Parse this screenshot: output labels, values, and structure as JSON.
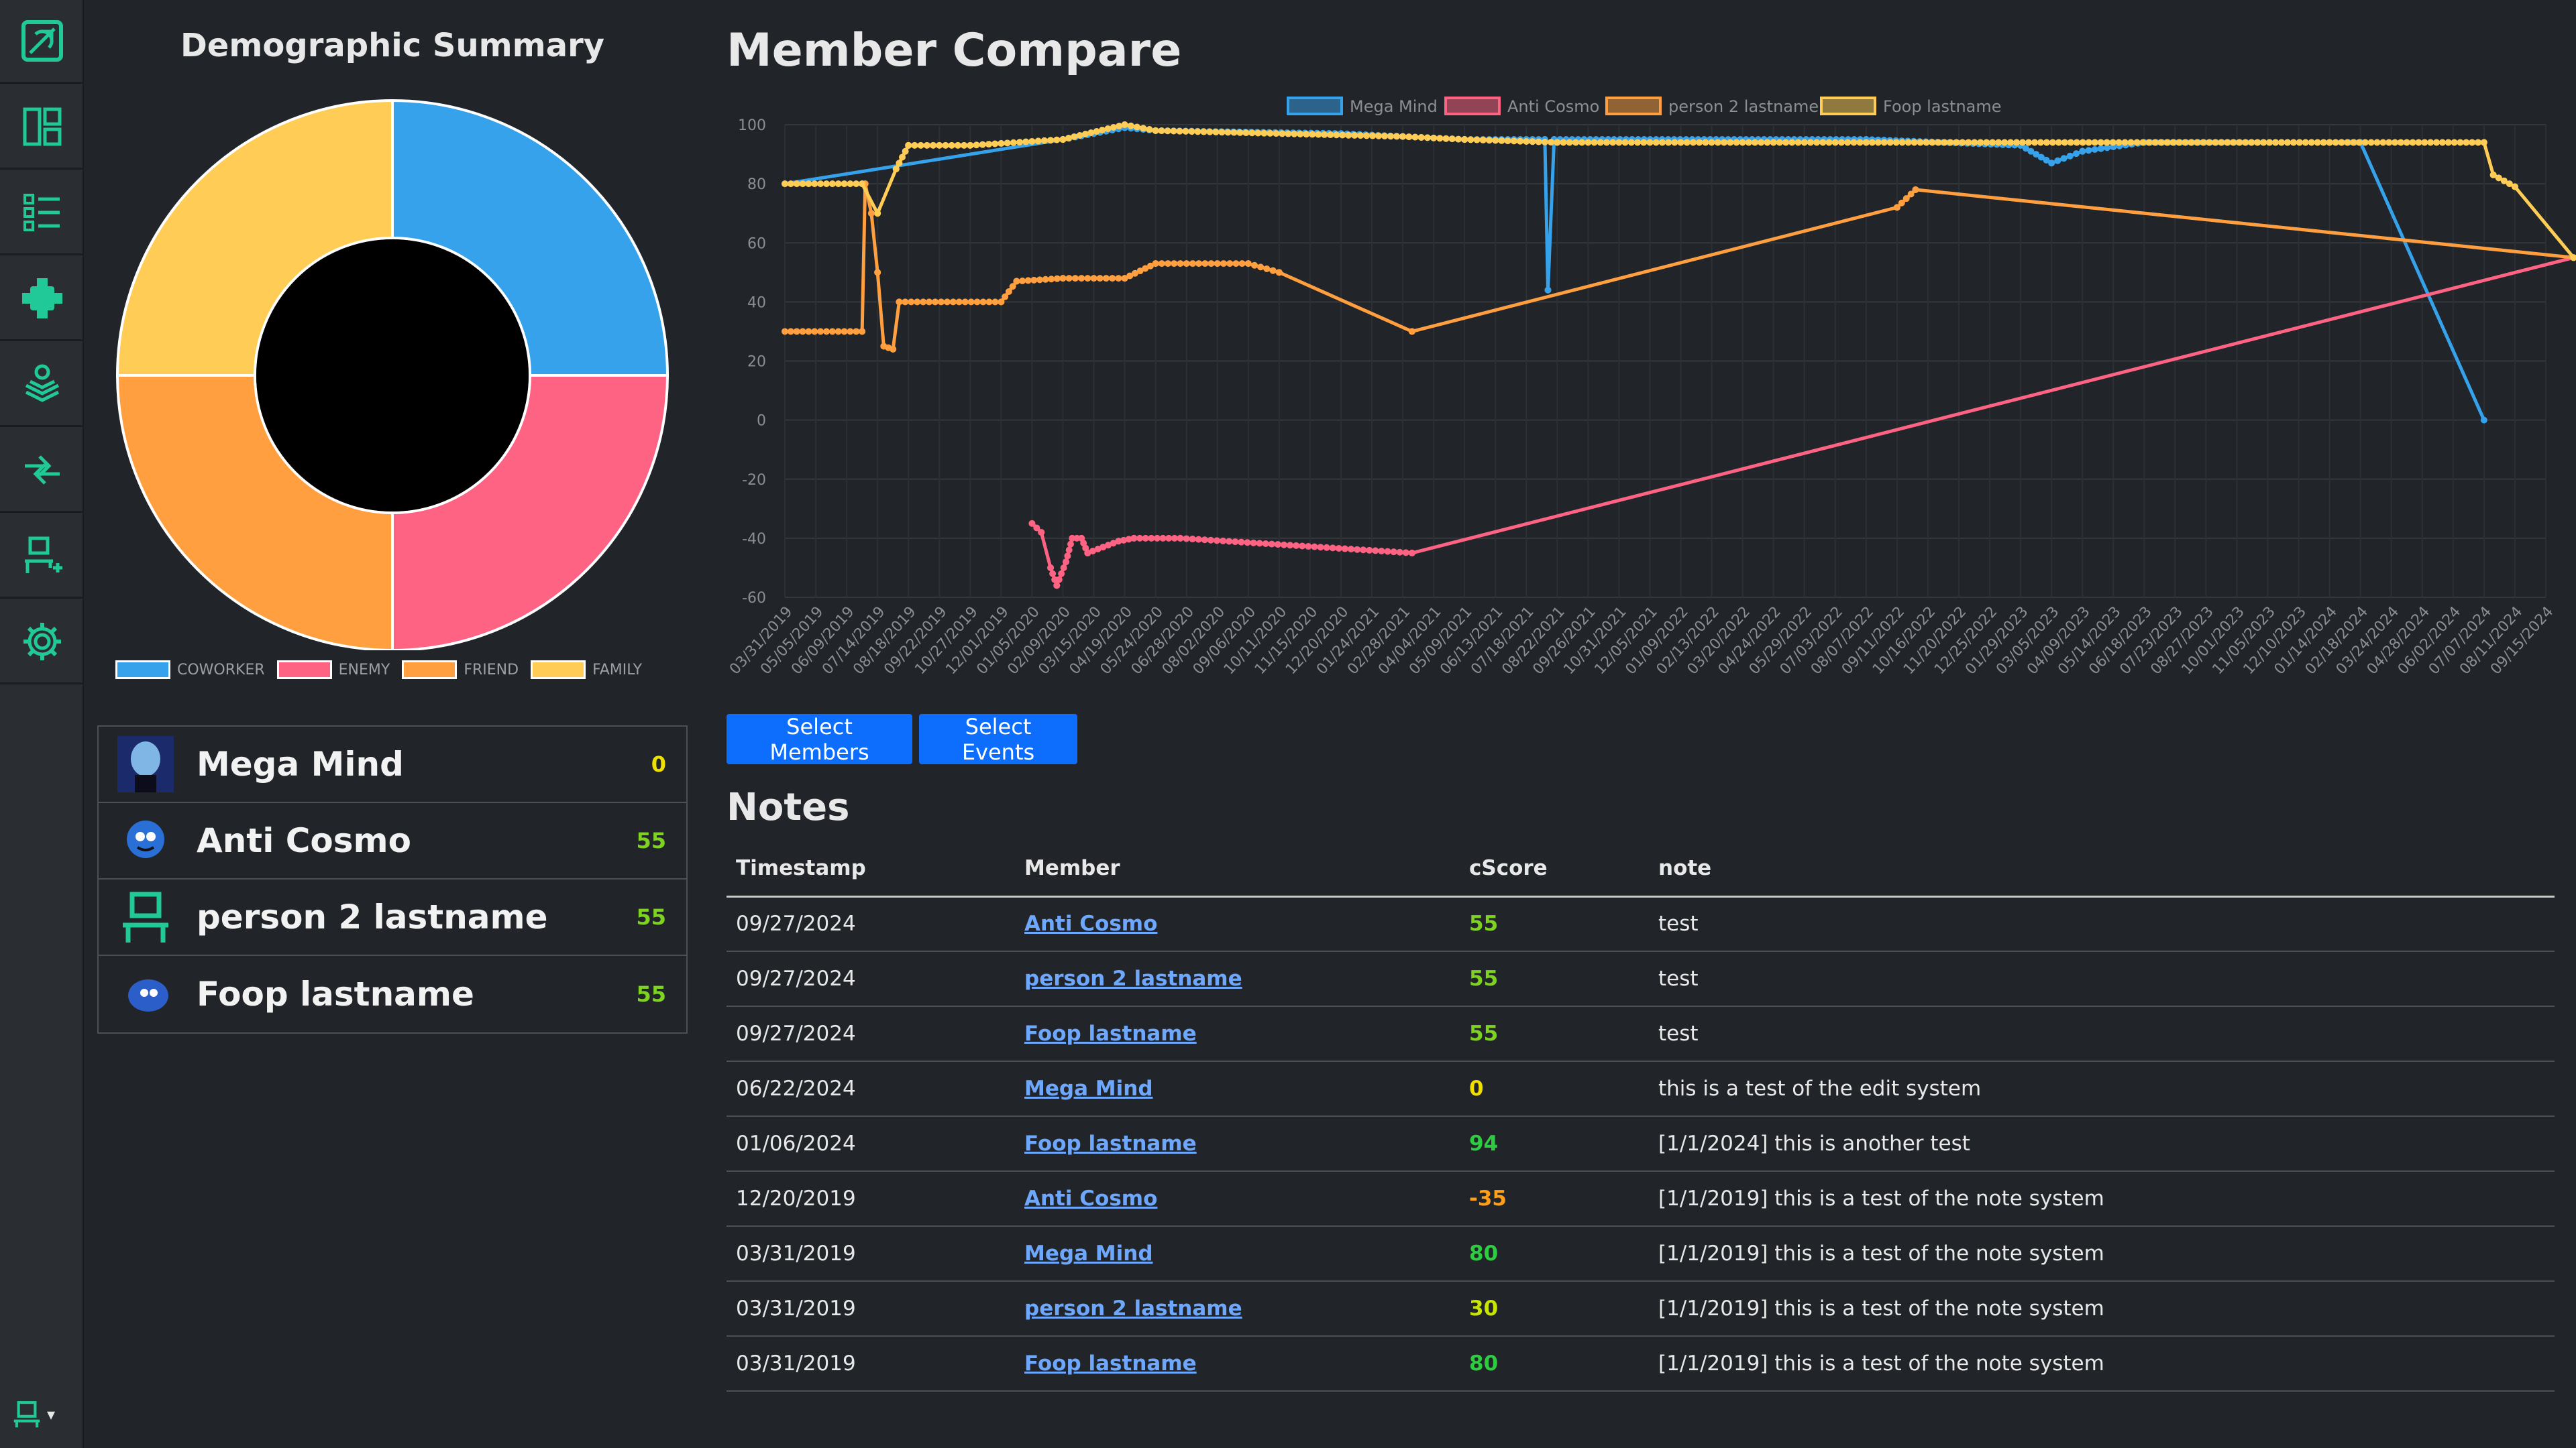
{
  "sidebar": {
    "items": [
      {
        "icon": "logo-icon"
      },
      {
        "icon": "dashboard-icon"
      },
      {
        "icon": "list-icon"
      },
      {
        "icon": "relationship-icon"
      },
      {
        "icon": "stack-icon"
      },
      {
        "icon": "compare-arrows-icon"
      },
      {
        "icon": "add-member-icon"
      },
      {
        "icon": "gear-icon"
      }
    ],
    "accent": "#20c997",
    "user_menu": {
      "icon": "user-icon",
      "caret": "▾"
    }
  },
  "demographic": {
    "title": "Demographic Summary",
    "segments": [
      {
        "label": "COWORKER",
        "value": 1,
        "color": "#36a2eb"
      },
      {
        "label": "ENEMY",
        "value": 1,
        "color": "#ff6384"
      },
      {
        "label": "FRIEND",
        "value": 1,
        "color": "#ff9f40"
      },
      {
        "label": "FAMILY",
        "value": 1,
        "color": "#ffcd56"
      }
    ]
  },
  "members": [
    {
      "name": "Mega Mind",
      "score": "0",
      "score_color": "#f0e000",
      "avatar": "megamind-avatar"
    },
    {
      "name": "Anti Cosmo",
      "score": "55",
      "score_color": "#7ed321",
      "avatar": "anticosmo-avatar"
    },
    {
      "name": "person 2 lastname",
      "score": "55",
      "score_color": "#7ed321",
      "avatar": "person-icon"
    },
    {
      "name": "Foop lastname",
      "score": "55",
      "score_color": "#7ed321",
      "avatar": "foop-avatar"
    }
  ],
  "compare": {
    "title": "Member Compare",
    "buttons": {
      "members": "Select Members",
      "events": "Select Events"
    }
  },
  "chart_data": {
    "type": "line",
    "title": "",
    "xlabel": "",
    "ylabel": "",
    "ylim": [
      -60,
      100
    ],
    "yticks": [
      "100",
      "80",
      "60",
      "40",
      "20",
      "0",
      "-20",
      "-40",
      "-60"
    ],
    "xticks": [
      "03/31/2019",
      "05/05/2019",
      "06/09/2019",
      "07/14/2019",
      "08/18/2019",
      "09/22/2019",
      "10/27/2019",
      "12/01/2019",
      "01/05/2020",
      "02/09/2020",
      "03/15/2020",
      "04/19/2020",
      "05/24/2020",
      "06/28/2020",
      "08/02/2020",
      "09/06/2020",
      "10/11/2020",
      "11/15/2020",
      "12/20/2020",
      "01/24/2021",
      "02/28/2021",
      "04/04/2021",
      "05/09/2021",
      "06/13/2021",
      "07/18/2021",
      "08/22/2021",
      "09/26/2021",
      "10/31/2021",
      "12/05/2021",
      "01/09/2022",
      "02/13/2022",
      "03/20/2022",
      "04/24/2022",
      "05/29/2022",
      "07/03/2022",
      "08/07/2022",
      "09/11/2022",
      "10/16/2022",
      "11/20/2022",
      "12/25/2022",
      "01/29/2023",
      "03/05/2023",
      "04/09/2023",
      "05/14/2023",
      "06/18/2023",
      "07/23/2023",
      "08/27/2023",
      "10/01/2023",
      "11/05/2023",
      "12/10/2023",
      "01/14/2024",
      "02/18/2024",
      "03/24/2024",
      "04/28/2024",
      "06/02/2024",
      "07/07/2024",
      "08/11/2024",
      "09/15/2024"
    ],
    "grid": true,
    "legend_position": "top",
    "series": [
      {
        "name": "Mega Mind",
        "color": "#36a2eb",
        "points": [
          [
            0,
            80
          ],
          [
            9,
            95
          ],
          [
            11,
            99
          ],
          [
            12,
            98
          ],
          [
            18,
            97
          ],
          [
            22,
            95
          ],
          [
            24,
            95
          ],
          [
            24.6,
            95
          ],
          [
            24.7,
            44
          ],
          [
            24.9,
            95
          ],
          [
            35,
            95
          ],
          [
            40,
            93
          ],
          [
            41,
            87
          ],
          [
            42,
            91
          ],
          [
            44,
            94
          ],
          [
            50,
            94
          ],
          [
            51,
            94
          ],
          [
            55,
            0
          ]
        ]
      },
      {
        "name": "Anti Cosmo",
        "color": "#ff6384",
        "points": [
          [
            8,
            -35
          ],
          [
            8.3,
            -38
          ],
          [
            8.6,
            -50
          ],
          [
            8.8,
            -56
          ],
          [
            9.1,
            -48
          ],
          [
            9.3,
            -40
          ],
          [
            9.6,
            -40
          ],
          [
            9.8,
            -45
          ],
          [
            10.3,
            -43
          ],
          [
            10.8,
            -41
          ],
          [
            11.3,
            -40
          ],
          [
            12.8,
            -40
          ],
          [
            20.3,
            -45
          ],
          [
            57.9,
            55
          ]
        ]
      },
      {
        "name": "person 2 lastname",
        "color": "#ff9f40",
        "points": [
          [
            0,
            30
          ],
          [
            2.5,
            30
          ],
          [
            2.6,
            80
          ],
          [
            2.8,
            70
          ],
          [
            3,
            50
          ],
          [
            3.2,
            25
          ],
          [
            3.5,
            24
          ],
          [
            3.7,
            40
          ],
          [
            7,
            40
          ],
          [
            7.5,
            47
          ],
          [
            9,
            48
          ],
          [
            11,
            48
          ],
          [
            12,
            53
          ],
          [
            15,
            53
          ],
          [
            16,
            50
          ],
          [
            20.3,
            30
          ],
          [
            36,
            72
          ],
          [
            36.6,
            78
          ],
          [
            57.9,
            55
          ]
        ]
      },
      {
        "name": "Foop lastname",
        "color": "#ffcd56",
        "points": [
          [
            0,
            80
          ],
          [
            2.5,
            80
          ],
          [
            3,
            70
          ],
          [
            3.6,
            85
          ],
          [
            4,
            93
          ],
          [
            6,
            93
          ],
          [
            9,
            95
          ],
          [
            11,
            100
          ],
          [
            12,
            98
          ],
          [
            20,
            96
          ],
          [
            22,
            95
          ],
          [
            25,
            94
          ],
          [
            29,
            94
          ],
          [
            32,
            94
          ],
          [
            35,
            94
          ],
          [
            50,
            94
          ],
          [
            55,
            94
          ],
          [
            55.3,
            83
          ],
          [
            56,
            79
          ],
          [
            57.9,
            55
          ]
        ]
      }
    ]
  },
  "notes": {
    "title": "Notes",
    "columns": [
      "Timestamp",
      "Member",
      "cScore",
      "note"
    ],
    "rows": [
      {
        "timestamp": "09/27/2024",
        "member": "Anti Cosmo",
        "cscore": "55",
        "color": "#7ed321",
        "note": "test"
      },
      {
        "timestamp": "09/27/2024",
        "member": "person 2 lastname",
        "cscore": "55",
        "color": "#7ed321",
        "note": "test"
      },
      {
        "timestamp": "09/27/2024",
        "member": "Foop lastname",
        "cscore": "55",
        "color": "#7ed321",
        "note": "test"
      },
      {
        "timestamp": "06/22/2024",
        "member": "Mega Mind",
        "cscore": "0",
        "color": "#f0e000",
        "note": "this is a test of the edit system"
      },
      {
        "timestamp": "01/06/2024",
        "member": "Foop lastname",
        "cscore": "94",
        "color": "#2ecc40",
        "note": "[1/1/2024] this is another test"
      },
      {
        "timestamp": "12/20/2019",
        "member": "Anti Cosmo",
        "cscore": "-35",
        "color": "#ff9f1a",
        "note": "[1/1/2019] this is a test of the note system"
      },
      {
        "timestamp": "03/31/2019",
        "member": "Mega Mind",
        "cscore": "80",
        "color": "#2ecc40",
        "note": "[1/1/2019] this is a test of the note system"
      },
      {
        "timestamp": "03/31/2019",
        "member": "person 2 lastname",
        "cscore": "30",
        "color": "#c8e600",
        "note": "[1/1/2019] this is a test of the note system"
      },
      {
        "timestamp": "03/31/2019",
        "member": "Foop lastname",
        "cscore": "80",
        "color": "#2ecc40",
        "note": "[1/1/2019] this is a test of the note system"
      }
    ]
  }
}
